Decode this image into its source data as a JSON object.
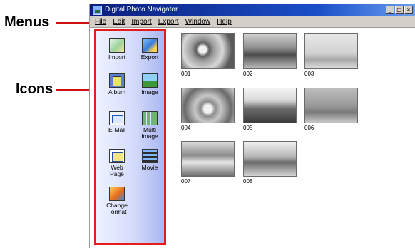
{
  "annotations": {
    "menus_label": "Menus",
    "icons_label": "Icons"
  },
  "window": {
    "title": "Digital Photo Navigator",
    "controls": [
      "_",
      "□",
      "×"
    ]
  },
  "menu": {
    "file": "File",
    "edit": "Edit",
    "import": "Import",
    "export": "Export",
    "window": "Window",
    "help": "Help"
  },
  "tools": {
    "import": "Import",
    "export": "Export",
    "album": "Album",
    "image": "Image",
    "email": "E-Mail",
    "multi_image": "Multi\nImage",
    "web_page": "Web\nPage",
    "movie": "Movie",
    "change_format": "Change\nFormat"
  },
  "thumbnails": {
    "t001": "001",
    "t002": "002",
    "t003": "003",
    "t004": "004",
    "t005": "005",
    "t006": "006",
    "t007": "007",
    "t008": "008"
  },
  "colors": {
    "callout_line": "#d01010",
    "sidebar_border": "#e61c1c",
    "titlebar": "#0a1e7c"
  }
}
